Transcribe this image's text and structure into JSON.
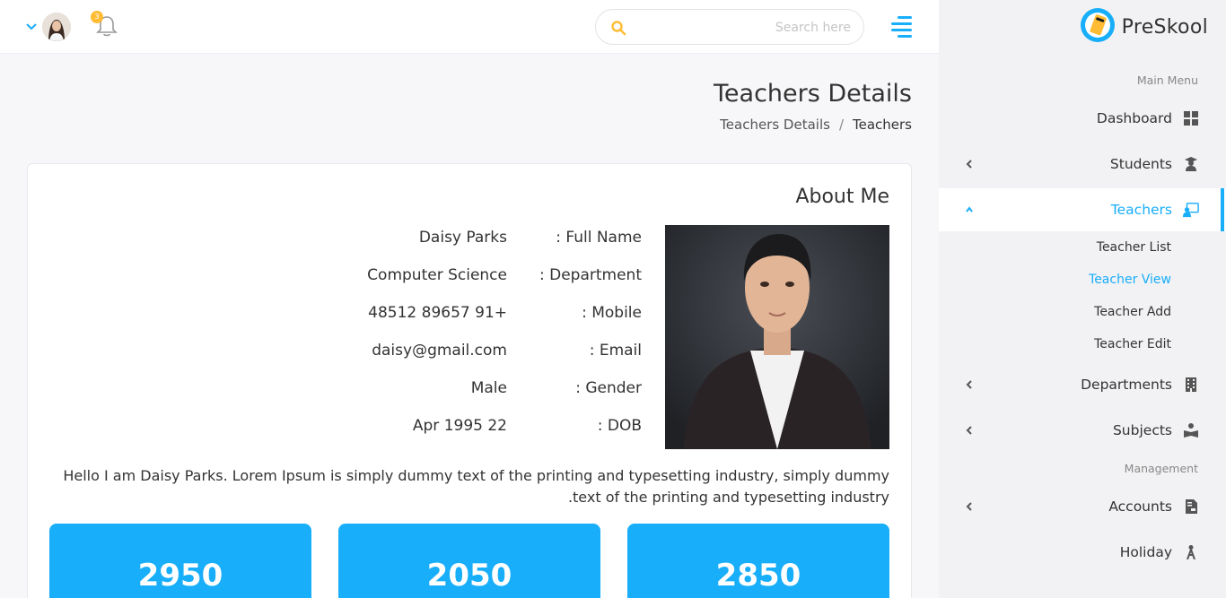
{
  "header": {
    "search_placeholder": "Search here",
    "notification_count": "3"
  },
  "sidebar": {
    "logo": "PreSkool",
    "main_menu_title": "Main Menu",
    "management_title": "Management",
    "items": [
      {
        "label": "Dashboard",
        "icon": "dashboard-icon"
      },
      {
        "label": "Students",
        "icon": "student-icon"
      },
      {
        "label": "Teachers",
        "icon": "teacher-icon"
      },
      {
        "label": "Departments",
        "icon": "building-icon"
      },
      {
        "label": "Subjects",
        "icon": "book-reader-icon"
      },
      {
        "label": "Accounts",
        "icon": "invoice-icon"
      },
      {
        "label": "Holiday",
        "icon": "holiday-icon"
      }
    ],
    "teacher_sub_items": [
      "Teacher List",
      "Teacher View",
      "Teacher Add",
      "Teacher Edit"
    ],
    "active_color": "#18aefa"
  },
  "page": {
    "title": "Teachers Details",
    "breadcrumb": {
      "link": "Teachers Details",
      "separator": "/",
      "current": "Teachers"
    }
  },
  "about": {
    "title": "About Me",
    "fields": [
      {
        "label": ": Full Name",
        "value": "Daisy Parks"
      },
      {
        "label": ": Department",
        "value": "Computer Science"
      },
      {
        "label": ": Mobile",
        "value": "48512 89657 91+"
      },
      {
        "label": ": Email",
        "value": "daisy@gmail.com"
      },
      {
        "label": ": Gender",
        "value": "Male"
      },
      {
        "label": ": DOB",
        "value": "Apr 1995 22"
      }
    ],
    "bio": "Hello I am Daisy Parks. Lorem Ipsum is simply dummy text of the printing and typesetting industry, simply dummy text of the printing and typesetting industry."
  },
  "stats": [
    "2950",
    "2050",
    "2850"
  ]
}
